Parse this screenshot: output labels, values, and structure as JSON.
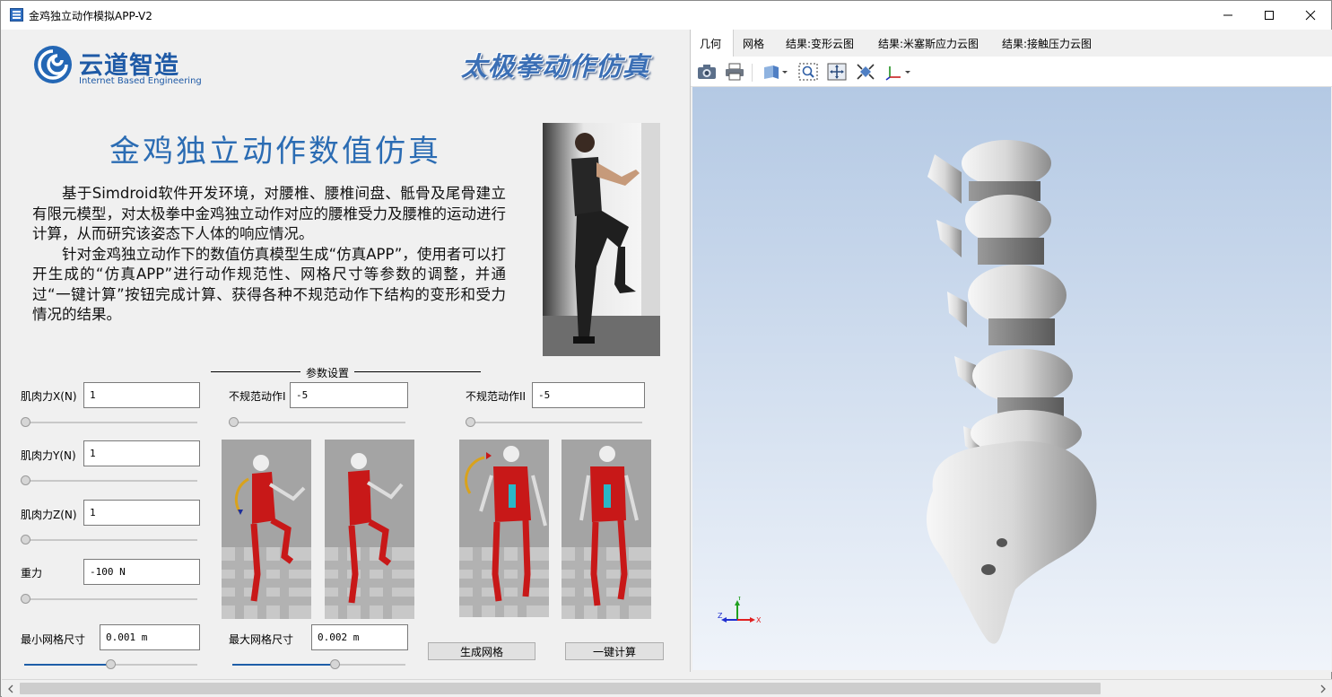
{
  "window": {
    "title": "金鸡独立动作模拟APP-V2",
    "controls": {
      "minimize": "minimize",
      "maximize": "maximize",
      "close": "close"
    }
  },
  "header": {
    "logo_cn": "云道智造",
    "logo_en": "Internet Based Engineering",
    "banner": "太极拳动作仿真"
  },
  "main": {
    "title": "金鸡独立动作数值仿真",
    "paragraph1": "基于Simdroid软件开发环境，对腰椎、腰椎间盘、骶骨及尾骨建立有限元模型，对太极拳中金鸡独立动作对应的腰椎受力及腰椎的运动进行计算，从而研究该姿态下人体的响应情况。",
    "paragraph2": "针对金鸡独立动作下的数值仿真模型生成“仿真APP”，使用者可以打开生成的“仿真APP”进行动作规范性、网格尺寸等参数的调整，并通过“一键计算”按钮完成计算、获得各种不规范动作下结构的变形和受力情况的结果。"
  },
  "params": {
    "section_title": "参数设置",
    "muscle_x": {
      "label": "肌肉力X(N)",
      "value": "1",
      "slider": 0.0
    },
    "muscle_y": {
      "label": "肌肉力Y(N)",
      "value": "1",
      "slider": 0.0
    },
    "muscle_z": {
      "label": "肌肉力Z(N)",
      "value": "1",
      "slider": 0.0
    },
    "gravity": {
      "label": "重力",
      "value": "-100 N",
      "slider": 0.0
    },
    "min_mesh": {
      "label": "最小网格尺寸",
      "value": "0.001 m",
      "slider": 0.5
    },
    "irregular1": {
      "label": "不规范动作I",
      "value": "-5",
      "slider": 0.0
    },
    "irregular2": {
      "label": "不规范动作II",
      "value": "-5",
      "slider": 0.0
    },
    "max_mesh": {
      "label": "最大网格尺寸",
      "value": "0.002 m",
      "slider": 0.6
    },
    "generate_button": "生成网格",
    "compute_button": "一键计算"
  },
  "viewer": {
    "tabs": [
      "几何",
      "网格",
      "结果:变形云图",
      "结果:米塞斯应力云图",
      "结果:接触压力云图"
    ],
    "active_tab": 0,
    "tools": [
      "camera-icon",
      "print-icon",
      "view-cube-icon",
      "zoom-box-icon",
      "pan-icon",
      "fit-icon",
      "axes-icon"
    ],
    "axis_labels": {
      "x": "X",
      "y": "Y",
      "z": "Z"
    },
    "colors": {
      "x": "#e02020",
      "y": "#20a020",
      "z": "#2030d0"
    }
  }
}
